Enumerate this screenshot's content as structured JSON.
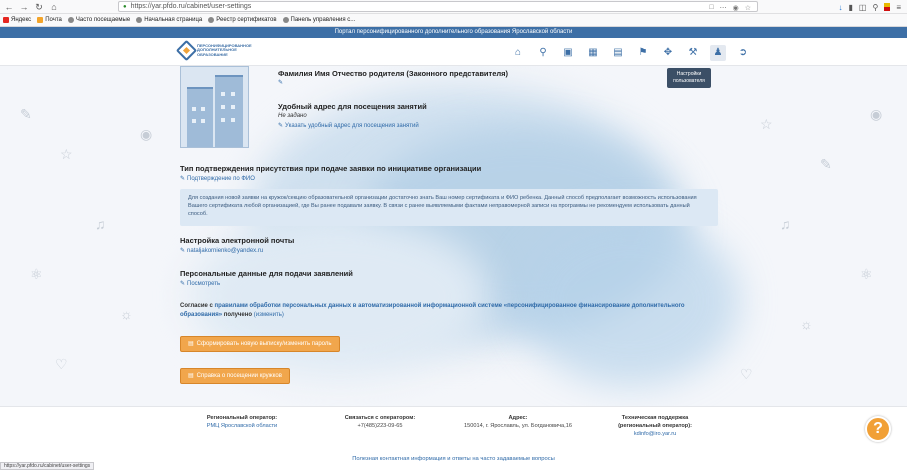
{
  "browser": {
    "url": "https://yar.pfdo.ru/cabinet/user-settings",
    "bookmarks": [
      "Яндекс",
      "Почта",
      "Часто посещаемые",
      "Начальная страница",
      "Реестр сертификатов",
      "Панель управления с..."
    ],
    "status_url": "https://yar.pfdo.ru/cabinet/user-settings"
  },
  "portal_bar": "Портал персонифицированного дополнительного образования Ярославской области",
  "logo_text": "Персонифицированное дополнительное образование",
  "tooltip": "Настройки пользователя",
  "parent": {
    "name_title": "Фамилия Имя Отчество родителя (Законного представителя)"
  },
  "address": {
    "title": "Удобный адрес для посещения занятий",
    "value": "Не задано",
    "link": "Указать удобный адрес для посещения занятий"
  },
  "confirmation": {
    "title": "Тип подтверждения присутствия при подаче заявки по инициативе организации",
    "link": "Подтверждение по ФИО",
    "info": "Для создания новой заявки на кружок/секцию образовательной организации достаточно знать Ваш номер сертификата и ФИО ребенка. Данный способ предполагает возможность использования Вашего сертификата любой организацией, где Вы ранее подавали заявку. В связи с ранее выявляемыми фактами неправомерной записи на программы не рекомендуем использовать данный способ."
  },
  "email": {
    "title": "Настройка электронной почты",
    "value": "nataljakornienko@yandex.ru"
  },
  "personal": {
    "title": "Персональные данные для подачи заявлений",
    "link": "Посмотреть"
  },
  "consent": {
    "prefix": "Согласие с",
    "link": "правилами обработки персональных данных в автоматизированной информационной системе «персонифицированное финансирование дополнительного образования»",
    "suffix": "получено",
    "change": "(изменить)"
  },
  "buttons": {
    "statement": "Сформировать новую выписку/изменить пароль",
    "help": "Справка о посещении кружков"
  },
  "footer": {
    "col1_title": "Региональный оператор:",
    "col1_value": "РМЦ Ярославской области",
    "col2_title": "Связаться с оператором:",
    "col2_value": "+7(485)223-09-65",
    "col3_title": "Адрес:",
    "col3_value": "150014, г. Ярославль, ул. Богдановича,16",
    "col4_title": "Техническая поддержка (региональный оператор):",
    "col4_value": "kdinfo@iro.yar.ru",
    "faq": "Полезная контактная информация и ответы на часто задаваемые вопросы"
  },
  "help_symbol": "?",
  "colors": {
    "portal_bar": "#3d6fa6",
    "link": "#2f6aa8",
    "button": "#f1a64c"
  }
}
